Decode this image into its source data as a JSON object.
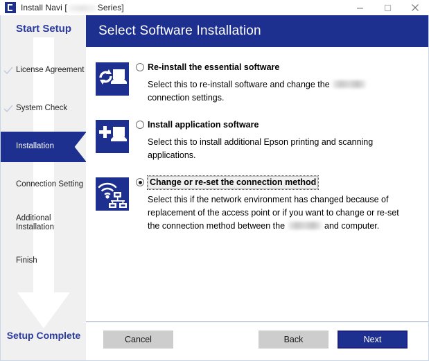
{
  "window": {
    "title_prefix": "Install Navi [",
    "title_suffix": "Series]",
    "app_icon": "epson-install-navi-icon",
    "controls": {
      "minimize": "minimize-icon",
      "maximize": "maximize-icon",
      "close": "close-icon"
    }
  },
  "sidebar": {
    "title": "Start Setup",
    "footer": "Setup Complete",
    "items": [
      {
        "label": "License Agreement",
        "state": "done"
      },
      {
        "label": "System Check",
        "state": "done"
      },
      {
        "label": "Installation",
        "state": "active"
      },
      {
        "label": "Connection Setting",
        "state": "pending"
      },
      {
        "label": "Additional\nInstallation",
        "state": "pending"
      },
      {
        "label": "Finish",
        "state": "pending"
      }
    ]
  },
  "header": {
    "title": "Select Software Installation"
  },
  "options": [
    {
      "icon": "reinstall-software-icon",
      "title": "Re-install the essential software",
      "desc_before": "Select this to re-install software and change the ",
      "desc_after": " connection settings.",
      "selected": false,
      "focused": false,
      "redacted": true
    },
    {
      "icon": "add-application-icon",
      "title": "Install application software",
      "desc_before": "Select this to install additional Epson printing and scanning applications.",
      "desc_after": "",
      "selected": false,
      "focused": false,
      "redacted": false
    },
    {
      "icon": "wireless-network-icon",
      "title": "Change or re-set the connection method",
      "desc_before": "Select this if the network environment has changed because of replacement of the access point or if you want to change or re-set the connection method between the ",
      "desc_after": " and computer.",
      "selected": true,
      "focused": true,
      "redacted": true
    }
  ],
  "footer": {
    "cancel_label": "Cancel",
    "back_label": "Back",
    "next_label": "Next"
  },
  "colors": {
    "brand_blue": "#1d2f8f",
    "sidebar_bg": "#f0f0f0",
    "button_gray": "#cdcdcd",
    "accent_text": "#2a3a9e"
  }
}
